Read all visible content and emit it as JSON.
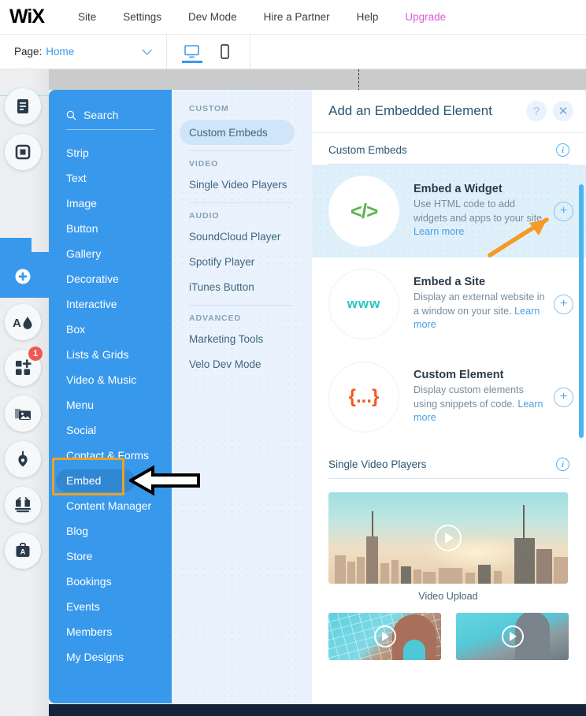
{
  "topbar": {
    "logo": "WiX",
    "menu": [
      {
        "label": "Site"
      },
      {
        "label": "Settings"
      },
      {
        "label": "Dev Mode"
      },
      {
        "label": "Hire a Partner"
      },
      {
        "label": "Help"
      },
      {
        "label": "Upgrade"
      }
    ]
  },
  "subbar": {
    "page_label": "Page:",
    "page_value": "Home",
    "desktop_icon": "desktop-icon",
    "mobile_icon": "mobile-icon"
  },
  "rail": {
    "items": [
      {
        "icon": "pages-icon",
        "badge": ""
      },
      {
        "icon": "sections-icon",
        "badge": ""
      },
      {
        "icon": "add-plus-icon",
        "badge": ""
      },
      {
        "icon": "design-theme-icon",
        "badge": ""
      },
      {
        "icon": "apps-add-icon",
        "badge": "1"
      },
      {
        "icon": "media-images-icon",
        "badge": ""
      },
      {
        "icon": "blog-pen-icon",
        "badge": ""
      },
      {
        "icon": "bookings-icon",
        "badge": ""
      },
      {
        "icon": "business-tools-icon",
        "badge": ""
      }
    ]
  },
  "bluepanel": {
    "search_placeholder": "Search",
    "search_icon": "search-icon",
    "items": [
      {
        "label": "Strip",
        "selected": false
      },
      {
        "label": "Text",
        "selected": false
      },
      {
        "label": "Image",
        "selected": false
      },
      {
        "label": "Button",
        "selected": false
      },
      {
        "label": "Gallery",
        "selected": false
      },
      {
        "label": "Decorative",
        "selected": false
      },
      {
        "label": "Interactive",
        "selected": false
      },
      {
        "label": "Box",
        "selected": false
      },
      {
        "label": "Lists & Grids",
        "selected": false
      },
      {
        "label": "Video & Music",
        "selected": false
      },
      {
        "label": "Menu",
        "selected": false
      },
      {
        "label": "Social",
        "selected": false
      },
      {
        "label": "Contact & Forms",
        "selected": false
      },
      {
        "label": "Embed",
        "selected": true
      },
      {
        "label": "Content Manager",
        "selected": false
      },
      {
        "label": "Blog",
        "selected": false
      },
      {
        "label": "Store",
        "selected": false
      },
      {
        "label": "Bookings",
        "selected": false
      },
      {
        "label": "Events",
        "selected": false
      },
      {
        "label": "Members",
        "selected": false
      },
      {
        "label": "My Designs",
        "selected": false
      }
    ]
  },
  "categories": [
    {
      "group": "CUSTOM",
      "items": [
        {
          "label": "Custom Embeds",
          "selected": true
        }
      ]
    },
    {
      "group": "VIDEO",
      "items": [
        {
          "label": "Single Video Players",
          "selected": false
        }
      ]
    },
    {
      "group": "AUDIO",
      "items": [
        {
          "label": "SoundCloud Player",
          "selected": false
        },
        {
          "label": "Spotify Player",
          "selected": false
        },
        {
          "label": "iTunes Button",
          "selected": false
        }
      ]
    },
    {
      "group": "ADVANCED",
      "items": [
        {
          "label": "Marketing Tools",
          "selected": false
        },
        {
          "label": "Velo Dev Mode",
          "selected": false
        }
      ]
    }
  ],
  "rightpanel": {
    "title": "Add an Embedded Element",
    "help_icon": "question-mark-icon",
    "close_icon": "close-icon",
    "sections": [
      {
        "title": "Custom Embeds",
        "info_icon": "info-icon",
        "items": [
          {
            "thumb_icon": "code-brackets-icon",
            "thumb_text": "</>",
            "name": "Embed a Widget",
            "desc": "Use HTML code to add widgets and apps to your site.",
            "learn_more": "Learn more",
            "add_icon": "plus-icon",
            "hovered": true
          },
          {
            "thumb_icon": "www-icon",
            "thumb_text": "www",
            "name": "Embed a Site",
            "desc": "Display an external website in a window on your site.",
            "learn_more": "Learn more",
            "add_icon": "plus-icon",
            "hovered": false
          },
          {
            "thumb_icon": "curly-braces-icon",
            "thumb_text": "{...}",
            "name": "Custom Element",
            "desc": "Display custom elements using snippets of code.",
            "learn_more": "Learn more",
            "add_icon": "plus-icon",
            "hovered": false
          }
        ]
      },
      {
        "title": "Single Video Players",
        "info_icon": "info-icon",
        "video_caption": "Video Upload",
        "play_icon": "play-icon"
      }
    ],
    "scrollbar": "vertical-scrollbar"
  },
  "annotations": {
    "embed_highlight_color": "#eda21d",
    "arrow_to_plus_color": "#f79a24",
    "arrow_to_embed_color": "#000000"
  },
  "colors": {
    "accent_blue": "#3899ec",
    "panel_blue": "#3899ec",
    "category_bg": "#eaf3fd",
    "upgrade_pink": "#d95bd9",
    "badge_red": "#ee5951"
  }
}
